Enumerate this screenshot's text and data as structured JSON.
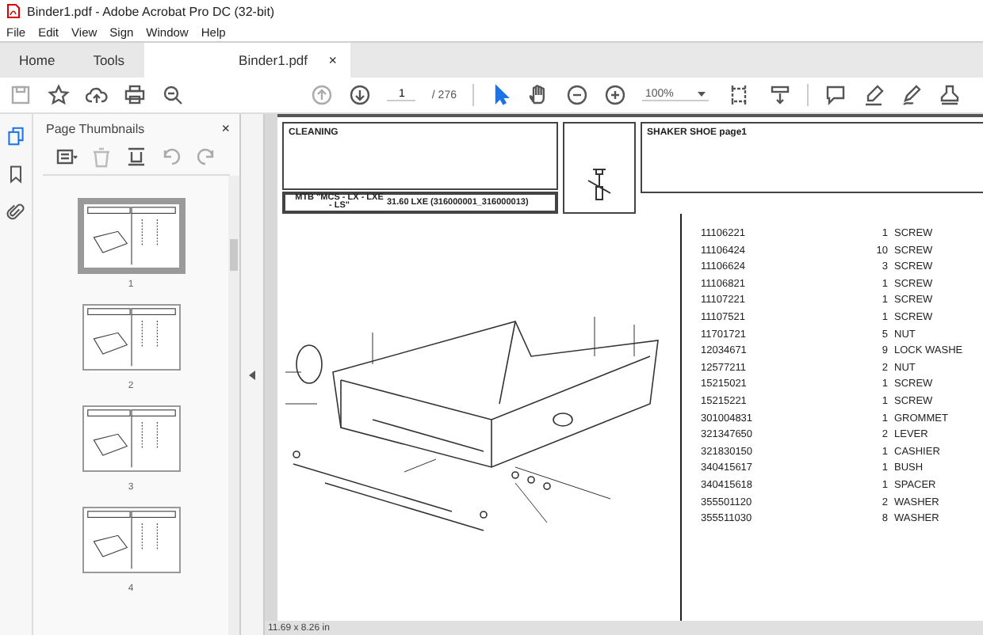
{
  "window": {
    "title": "Binder1.pdf - Adobe Acrobat Pro DC (32-bit)"
  },
  "menu": [
    "File",
    "Edit",
    "View",
    "Sign",
    "Window",
    "Help"
  ],
  "tabs": [
    {
      "label": "Home",
      "selected": false,
      "kind": "nav"
    },
    {
      "label": "Tools",
      "selected": false,
      "kind": "nav"
    },
    {
      "label": "Binder1.pdf",
      "selected": true,
      "kind": "document",
      "close": "×"
    }
  ],
  "toolbar": {
    "page": "1",
    "page_count": "/ 276",
    "zoom": "100%"
  },
  "thumbnails": {
    "title": "Page Thumbnails",
    "close": "×",
    "pages": [
      {
        "label": "1",
        "selected": true
      },
      {
        "label": "2",
        "selected": false
      },
      {
        "label": "3",
        "selected": false
      },
      {
        "label": "4",
        "selected": false
      }
    ]
  },
  "document": {
    "section": "CLEANING",
    "model": "MTB \"MCS - LX - LXE - LS\"",
    "model_detail": "31.60 LXE (316000001_316000013)",
    "title": "SHAKER SHOE  page1",
    "parts": [
      {
        "code": "11106221",
        "qty": "1",
        "name": "SCREW"
      },
      {
        "code": "11106424",
        "qty": "10",
        "name": "SCREW"
      },
      {
        "code": "11106624",
        "qty": "3",
        "name": "SCREW"
      },
      {
        "code": "11106821",
        "qty": "1",
        "name": "SCREW"
      },
      {
        "code": "11107221",
        "qty": "1",
        "name": "SCREW"
      },
      {
        "code": "11107521",
        "qty": "1",
        "name": "SCREW"
      },
      {
        "code": "11701721",
        "qty": "5",
        "name": "NUT"
      },
      {
        "code": "12034671",
        "qty": "9",
        "name": "LOCK WASHE"
      },
      {
        "code": "12577211",
        "qty": "2",
        "name": "NUT"
      },
      {
        "code": "15215021",
        "qty": "1",
        "name": "SCREW"
      },
      {
        "code": "15215221",
        "qty": "1",
        "name": "SCREW"
      },
      {
        "code": "301004831",
        "qty": "1",
        "name": "GROMMET"
      },
      {
        "code": "321347650",
        "qty": "2",
        "name": "LEVER"
      },
      {
        "code": "321830150",
        "qty": "1",
        "name": "CASHIER"
      },
      {
        "code": "340415617",
        "qty": "1",
        "name": "BUSH"
      },
      {
        "code": "340415618",
        "qty": "1",
        "name": "SPACER"
      },
      {
        "code": "355501120",
        "qty": "2",
        "name": "WASHER"
      },
      {
        "code": "355511030",
        "qty": "8",
        "name": "WASHER"
      }
    ]
  },
  "status": {
    "page_size": "11.69 x 8.26 in"
  }
}
